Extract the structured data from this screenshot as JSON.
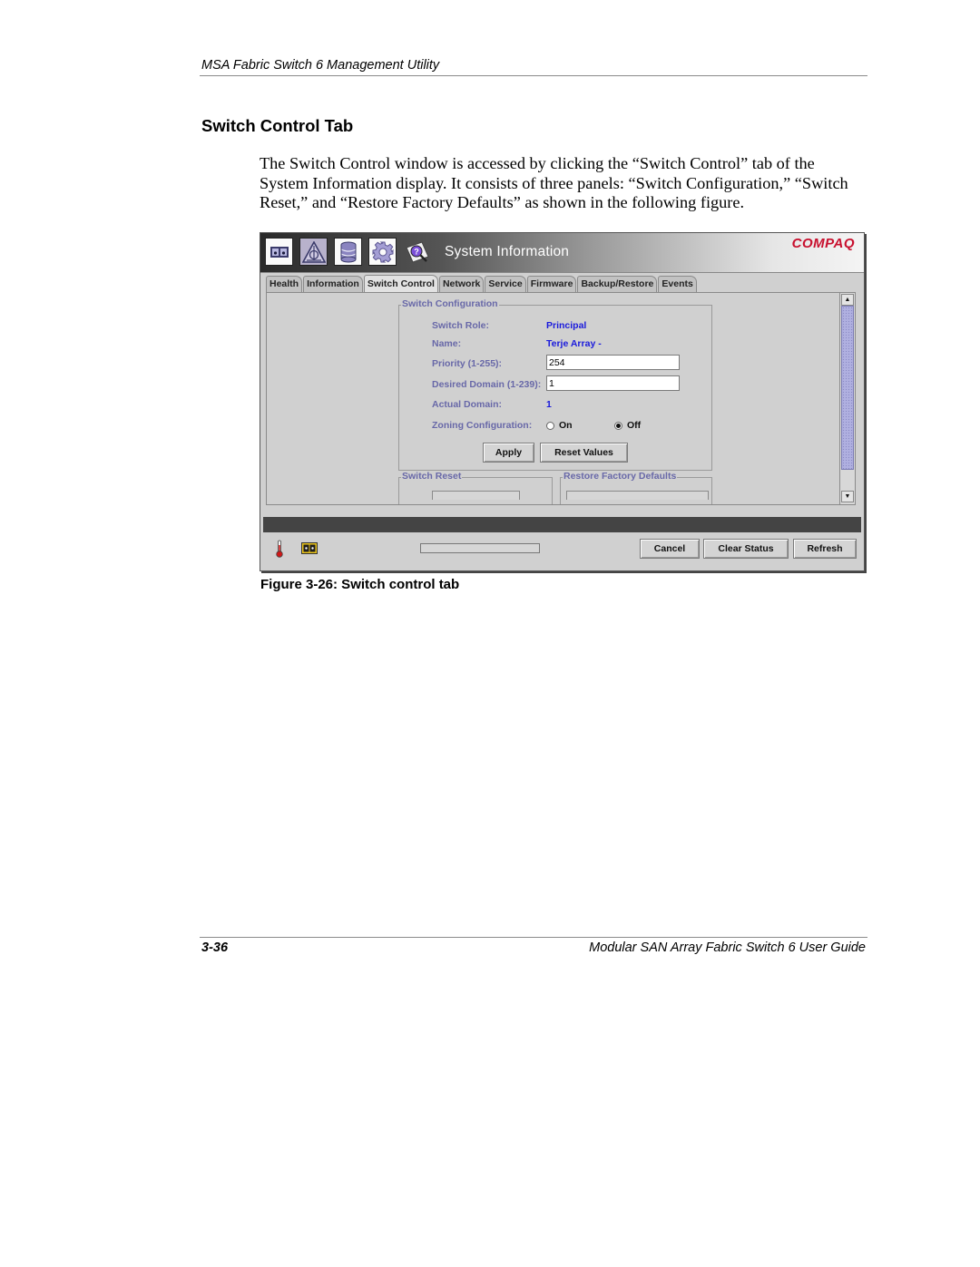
{
  "page": {
    "running_header": "MSA Fabric Switch 6 Management Utility",
    "section_title": "Switch Control Tab",
    "body_paragraph": "The Switch Control window is accessed by clicking the “Switch Control” tab of the System Information display. It consists of three panels: “Switch Configuration,” “Switch Reset,” and “Restore Factory Defaults” as shown in the following figure.",
    "figure_caption": "Figure 3-26:  Switch control tab",
    "footer": {
      "page_number": "3-36",
      "guide_title": "Modular SAN Array Fabric Switch 6 User Guide"
    }
  },
  "app": {
    "toolbar_icons": [
      {
        "name": "switch-view-icon",
        "active": false
      },
      {
        "name": "fabric-topology-icon",
        "active": true
      },
      {
        "name": "database-icon",
        "active": false
      },
      {
        "name": "gear-icon",
        "active": false
      },
      {
        "name": "help-magnifier-icon",
        "active": false
      }
    ],
    "window_title": "System Information",
    "brand": "COMPAQ",
    "tabs": [
      {
        "label": "Health",
        "selected": false
      },
      {
        "label": "Information",
        "selected": false
      },
      {
        "label": "Switch Control",
        "selected": true
      },
      {
        "label": "Network",
        "selected": false
      },
      {
        "label": "Service",
        "selected": false
      },
      {
        "label": "Firmware",
        "selected": false
      },
      {
        "label": "Backup/Restore",
        "selected": false
      },
      {
        "label": "Events",
        "selected": false
      }
    ],
    "switch_config": {
      "legend": "Switch Configuration",
      "role_label": "Switch Role:",
      "role_value": "Principal",
      "name_label": "Name:",
      "name_value": "Terje Array -",
      "priority_label": "Priority (1-255):",
      "priority_value": "254",
      "desired_domain_label": "Desired Domain (1-239):",
      "desired_domain_value": "1",
      "actual_domain_label": "Actual Domain:",
      "actual_domain_value": "1",
      "zoning_label": "Zoning Configuration:",
      "zoning_options": [
        {
          "label": "On",
          "checked": false
        },
        {
          "label": "Off",
          "checked": true
        }
      ],
      "apply_label": "Apply",
      "reset_values_label": "Reset Values"
    },
    "switch_reset": {
      "legend": "Switch Reset"
    },
    "restore_defaults": {
      "legend": "Restore Factory Defaults"
    },
    "status_bar": {
      "progress_percent": 0,
      "cancel_label": "Cancel",
      "clear_status_label": "Clear Status",
      "refresh_label": "Refresh"
    },
    "colors": {
      "brand_red": "#c8102e",
      "label_purple": "#6868a8",
      "value_blue": "#1a1adc"
    }
  }
}
